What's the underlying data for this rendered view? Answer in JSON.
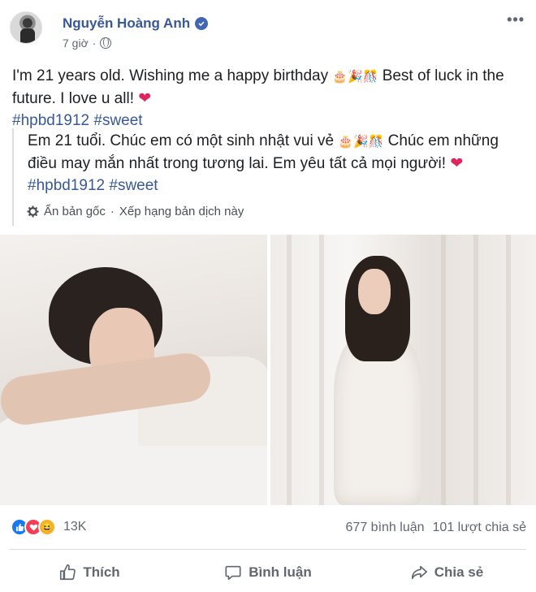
{
  "post": {
    "author": "Nguyễn Hoàng Anh",
    "time": "7 giờ",
    "dot": "·",
    "more": "•••",
    "text": "I'm 21 years old. Wishing me a happy birthday",
    "text_mid": "Best of luck in the future. I love u all!",
    "emoji_1": "🎂🎉🎊",
    "heart": "❤",
    "hashtags": "#hpbd1912 #sweet"
  },
  "translation": {
    "text_start": "Em 21 tuổi. Chúc em có một sinh nhật vui vẻ",
    "emoji": "🎂🎉🎊",
    "text_end": "Chúc em những điều may mắn nhất trong tương lai. Em yêu tất cả mọi người!",
    "heart": "❤",
    "hashtags": "#hpbd1912 #sweet",
    "show_original": "Ẩn bản gốc",
    "sep": "·",
    "rate": "Xếp hạng bản dịch này"
  },
  "stats": {
    "reaction_count": "13K",
    "comments": "677 bình luận",
    "shares": "101 lượt chia sẻ"
  },
  "actions": {
    "like": "Thích",
    "comment": "Bình luận",
    "share": "Chia sẻ"
  },
  "colors": {
    "link": "#385898",
    "like_blue": "#1877f2",
    "love_red": "#f33e58",
    "haha_yellow": "#f7b125"
  },
  "icons": [
    "verified-icon",
    "globe-icon",
    "more-icon",
    "gear-icon",
    "like-icon",
    "comment-icon",
    "share-icon"
  ]
}
